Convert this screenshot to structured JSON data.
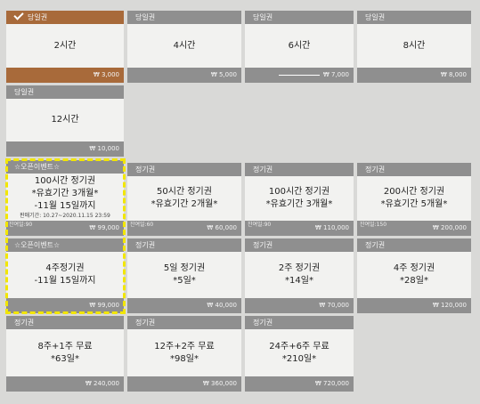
{
  "row1": [
    {
      "head": "당일권",
      "body": [
        "2시간"
      ],
      "price": "₩ 3,000",
      "selected": true
    },
    {
      "head": "당일권",
      "body": [
        "4시간"
      ],
      "price": "₩ 5,000"
    },
    {
      "head": "당일권",
      "body": [
        "6시간"
      ],
      "price": "₩ 7,000"
    },
    {
      "head": "당일권",
      "body": [
        "8시간"
      ],
      "price": "₩ 8,000"
    }
  ],
  "row2": [
    {
      "head": "당일권",
      "body": [
        "12시간"
      ],
      "price": "₩ 10,000"
    }
  ],
  "row3": [
    {
      "head": "☆오픈이벤트☆",
      "body": [
        "100시간 정기권",
        "*유효기간 3개월*",
        "-11월 15일까지"
      ],
      "small": "판매기간: 10.27~2020.11.15 23:59",
      "sale": "잔여일:90",
      "price": "₩ 99,000"
    },
    {
      "head": "정기권",
      "body": [
        "50시간 정기권",
        "*유효기간 2개월*"
      ],
      "sale": "잔여일:60",
      "price": "₩ 60,000"
    },
    {
      "head": "정기권",
      "body": [
        "100시간 정기권",
        "*유효기간 3개월*"
      ],
      "sale": "잔여일:90",
      "price": "₩ 110,000"
    },
    {
      "head": "정기권",
      "body": [
        "200시간 정기권",
        "*유효기간 5개월*"
      ],
      "sale": "잔여일:150",
      "price": "₩ 200,000"
    }
  ],
  "row4": [
    {
      "head": "☆오픈이벤트☆",
      "body": [
        "4주정기권",
        "-11월 15일까지"
      ],
      "price": "₩ 99,000"
    },
    {
      "head": "정기권",
      "body": [
        "5일 정기권",
        "*5일*"
      ],
      "price": "₩ 40,000"
    },
    {
      "head": "정기권",
      "body": [
        "2주 정기권",
        "*14일*"
      ],
      "price": "₩ 70,000"
    },
    {
      "head": "정기권",
      "body": [
        "4주 정기권",
        "*28일*"
      ],
      "price": "₩ 120,000"
    }
  ],
  "row5": [
    {
      "head": "정기권",
      "body": [
        "8주+1주 무료",
        "*63일*"
      ],
      "price": "₩ 240,000"
    },
    {
      "head": "정기권",
      "body": [
        "12주+2주 무료",
        "*98일*"
      ],
      "price": "₩ 360,000"
    },
    {
      "head": "정기권",
      "body": [
        "24주+6주 무료",
        "*210일*"
      ],
      "price": "₩ 720,000"
    }
  ],
  "colors": {
    "selected": "#a86a3a",
    "header": "#8f8f8f",
    "highlight": "#f2e600"
  }
}
